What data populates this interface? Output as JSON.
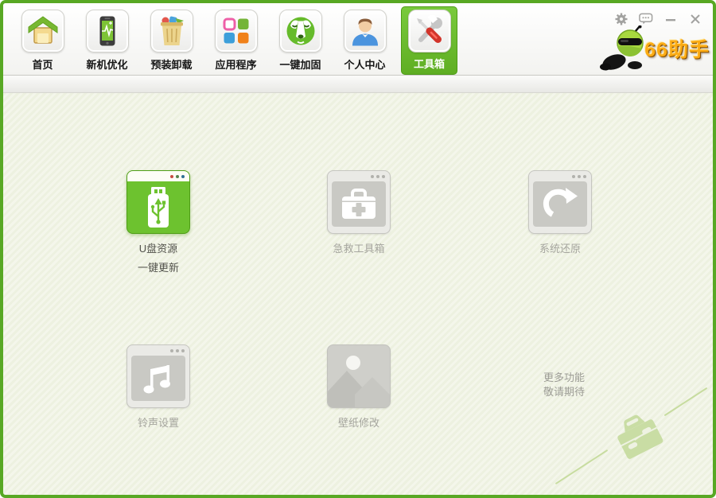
{
  "app": {
    "logo_text": "66助手"
  },
  "titlebar": {
    "controls": {
      "settings": "gear-icon",
      "feedback": "feedback-bubble-icon",
      "minimize": "minimize-icon",
      "close": "close-icon"
    }
  },
  "nav": {
    "items": [
      {
        "id": "home",
        "label": "首页",
        "selected": false
      },
      {
        "id": "new-device-optimize",
        "label": "新机优化",
        "selected": false
      },
      {
        "id": "preinstall-uninstall",
        "label": "预装卸载",
        "selected": false
      },
      {
        "id": "applications",
        "label": "应用程序",
        "selected": false
      },
      {
        "id": "one-key-reinforce",
        "label": "一键加固",
        "selected": false
      },
      {
        "id": "personal-center",
        "label": "个人中心",
        "selected": false
      },
      {
        "id": "toolbox",
        "label": "工具箱",
        "selected": true
      }
    ]
  },
  "tools": {
    "usb_update": {
      "label_line1": "U盘资源",
      "label_line2": "一键更新",
      "state": "active"
    },
    "first_aid_kit": {
      "label": "急救工具箱",
      "state": "disabled"
    },
    "system_restore": {
      "label": "系统还原",
      "state": "disabled"
    },
    "ringtone_settings": {
      "label": "铃声设置",
      "state": "disabled"
    },
    "wallpaper_edit": {
      "label": "壁纸修改",
      "state": "disabled"
    }
  },
  "coming_soon": {
    "line1": "更多功能",
    "line2": "敬请期待"
  },
  "colors": {
    "accent_green": "#6dc22f",
    "window_border": "#58a824",
    "disabled_tile_gray": "#c9c9c4",
    "disabled_text": "#a5a59e",
    "watermark_green": "#c9dda4",
    "logo_text_orange": "#fbab14"
  }
}
